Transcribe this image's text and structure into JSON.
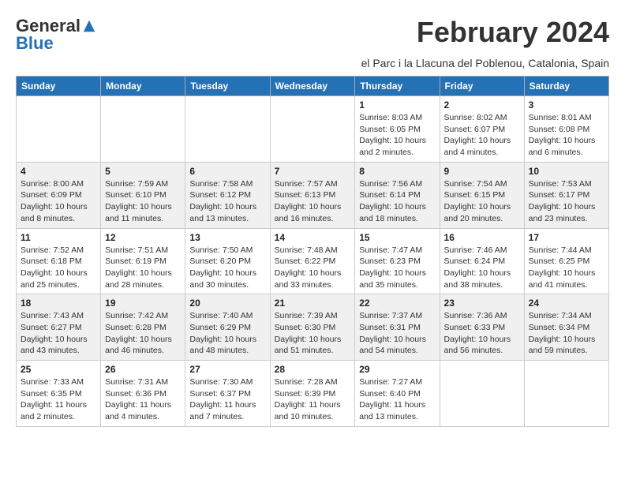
{
  "header": {
    "logo_general": "General",
    "logo_blue": "Blue",
    "month_title": "February 2024",
    "location": "el Parc i la Llacuna del Poblenou, Catalonia, Spain"
  },
  "weekdays": [
    "Sunday",
    "Monday",
    "Tuesday",
    "Wednesday",
    "Thursday",
    "Friday",
    "Saturday"
  ],
  "weeks": [
    {
      "shade": "white",
      "days": [
        {
          "num": "",
          "info": ""
        },
        {
          "num": "",
          "info": ""
        },
        {
          "num": "",
          "info": ""
        },
        {
          "num": "",
          "info": ""
        },
        {
          "num": "1",
          "info": "Sunrise: 8:03 AM\nSunset: 6:05 PM\nDaylight: 10 hours and 2 minutes."
        },
        {
          "num": "2",
          "info": "Sunrise: 8:02 AM\nSunset: 6:07 PM\nDaylight: 10 hours and 4 minutes."
        },
        {
          "num": "3",
          "info": "Sunrise: 8:01 AM\nSunset: 6:08 PM\nDaylight: 10 hours and 6 minutes."
        }
      ]
    },
    {
      "shade": "shaded",
      "days": [
        {
          "num": "4",
          "info": "Sunrise: 8:00 AM\nSunset: 6:09 PM\nDaylight: 10 hours and 8 minutes."
        },
        {
          "num": "5",
          "info": "Sunrise: 7:59 AM\nSunset: 6:10 PM\nDaylight: 10 hours and 11 minutes."
        },
        {
          "num": "6",
          "info": "Sunrise: 7:58 AM\nSunset: 6:12 PM\nDaylight: 10 hours and 13 minutes."
        },
        {
          "num": "7",
          "info": "Sunrise: 7:57 AM\nSunset: 6:13 PM\nDaylight: 10 hours and 16 minutes."
        },
        {
          "num": "8",
          "info": "Sunrise: 7:56 AM\nSunset: 6:14 PM\nDaylight: 10 hours and 18 minutes."
        },
        {
          "num": "9",
          "info": "Sunrise: 7:54 AM\nSunset: 6:15 PM\nDaylight: 10 hours and 20 minutes."
        },
        {
          "num": "10",
          "info": "Sunrise: 7:53 AM\nSunset: 6:17 PM\nDaylight: 10 hours and 23 minutes."
        }
      ]
    },
    {
      "shade": "white",
      "days": [
        {
          "num": "11",
          "info": "Sunrise: 7:52 AM\nSunset: 6:18 PM\nDaylight: 10 hours and 25 minutes."
        },
        {
          "num": "12",
          "info": "Sunrise: 7:51 AM\nSunset: 6:19 PM\nDaylight: 10 hours and 28 minutes."
        },
        {
          "num": "13",
          "info": "Sunrise: 7:50 AM\nSunset: 6:20 PM\nDaylight: 10 hours and 30 minutes."
        },
        {
          "num": "14",
          "info": "Sunrise: 7:48 AM\nSunset: 6:22 PM\nDaylight: 10 hours and 33 minutes."
        },
        {
          "num": "15",
          "info": "Sunrise: 7:47 AM\nSunset: 6:23 PM\nDaylight: 10 hours and 35 minutes."
        },
        {
          "num": "16",
          "info": "Sunrise: 7:46 AM\nSunset: 6:24 PM\nDaylight: 10 hours and 38 minutes."
        },
        {
          "num": "17",
          "info": "Sunrise: 7:44 AM\nSunset: 6:25 PM\nDaylight: 10 hours and 41 minutes."
        }
      ]
    },
    {
      "shade": "shaded",
      "days": [
        {
          "num": "18",
          "info": "Sunrise: 7:43 AM\nSunset: 6:27 PM\nDaylight: 10 hours and 43 minutes."
        },
        {
          "num": "19",
          "info": "Sunrise: 7:42 AM\nSunset: 6:28 PM\nDaylight: 10 hours and 46 minutes."
        },
        {
          "num": "20",
          "info": "Sunrise: 7:40 AM\nSunset: 6:29 PM\nDaylight: 10 hours and 48 minutes."
        },
        {
          "num": "21",
          "info": "Sunrise: 7:39 AM\nSunset: 6:30 PM\nDaylight: 10 hours and 51 minutes."
        },
        {
          "num": "22",
          "info": "Sunrise: 7:37 AM\nSunset: 6:31 PM\nDaylight: 10 hours and 54 minutes."
        },
        {
          "num": "23",
          "info": "Sunrise: 7:36 AM\nSunset: 6:33 PM\nDaylight: 10 hours and 56 minutes."
        },
        {
          "num": "24",
          "info": "Sunrise: 7:34 AM\nSunset: 6:34 PM\nDaylight: 10 hours and 59 minutes."
        }
      ]
    },
    {
      "shade": "white",
      "days": [
        {
          "num": "25",
          "info": "Sunrise: 7:33 AM\nSunset: 6:35 PM\nDaylight: 11 hours and 2 minutes."
        },
        {
          "num": "26",
          "info": "Sunrise: 7:31 AM\nSunset: 6:36 PM\nDaylight: 11 hours and 4 minutes."
        },
        {
          "num": "27",
          "info": "Sunrise: 7:30 AM\nSunset: 6:37 PM\nDaylight: 11 hours and 7 minutes."
        },
        {
          "num": "28",
          "info": "Sunrise: 7:28 AM\nSunset: 6:39 PM\nDaylight: 11 hours and 10 minutes."
        },
        {
          "num": "29",
          "info": "Sunrise: 7:27 AM\nSunset: 6:40 PM\nDaylight: 11 hours and 13 minutes."
        },
        {
          "num": "",
          "info": ""
        },
        {
          "num": "",
          "info": ""
        }
      ]
    }
  ]
}
